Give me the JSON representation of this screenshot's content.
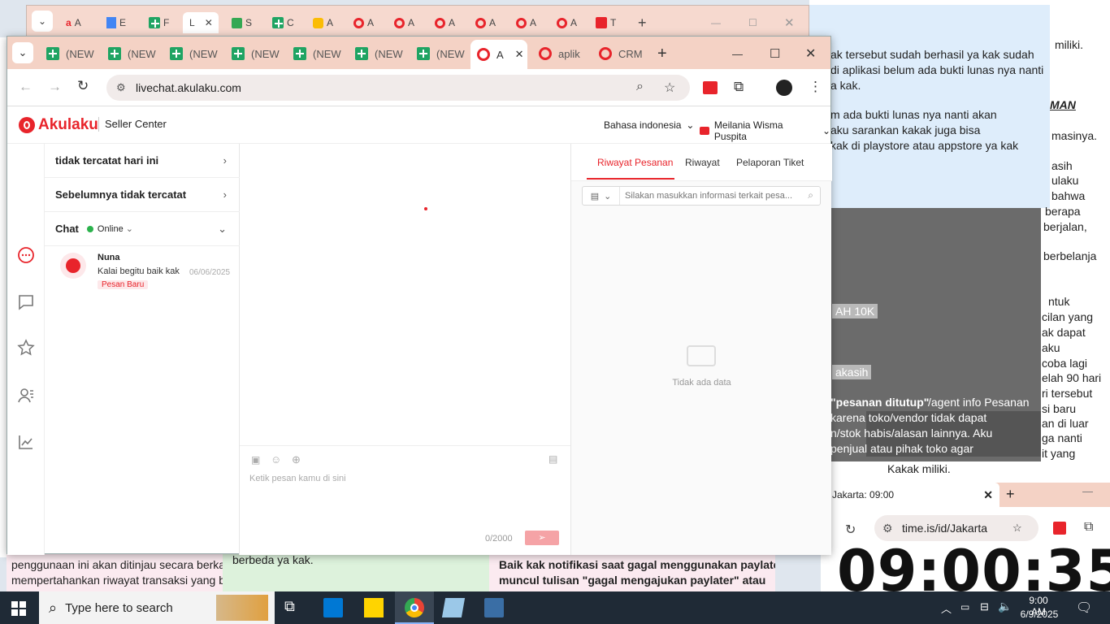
{
  "bg_top_window": {
    "tabs": [
      "A",
      "E",
      "F",
      "L",
      "S",
      "C",
      "A",
      "A",
      "A",
      "A",
      "A",
      "A",
      "T"
    ],
    "add_tab": "+"
  },
  "right_doc": {
    "blue_lines": [
      "ak tersebut sudah berhasil ya kak sudah",
      "di aplikasi belum ada bukti lunas nya nanti",
      "a kak.",
      "m ada bukti lunas nya nanti akan",
      " aku sarankan kakak juga bisa",
      "kak di playstore atau appstore ya kak"
    ],
    "side_lines": [
      "miliki.",
      "MAN",
      "masinya.",
      "asih",
      "ulaku",
      "bahwa",
      "berapa",
      "berjalan,",
      "berbelanja",
      "ntuk",
      "cilan yang",
      "ak dapat",
      "aku",
      "coba lagi",
      "elah 90 hari",
      "ri tersebut",
      "si baru",
      "an di luar",
      "ga nanti",
      "it yang"
    ],
    "popup_label_1": "AH 10K",
    "popup_label_2": "akasih",
    "bold_phrase": "\"pesanan ditutup\"",
    "popup_lines": [
      "/agent info Pesanan",
      "karena toko/vendor tidak dapat",
      "n/stok habis/alasan lainnya. Aku",
      "penjual atau pihak toko agar"
    ],
    "last_line": "Kakak miliki."
  },
  "bottom_strips": {
    "left_line1": "penggunaan ini akan ditinjau secara berka",
    "left_line2": "mempertahankan riwayat transaksi yang b",
    "middle_line": "berbeda ya kak.",
    "right_line1": "Baik kak notifikasi saat gagal menggunakan paylate",
    "right_line2": "muncul tulisan \"gagal mengajukan paylater\" atau"
  },
  "clock_window": {
    "tab_title": "Jakarta: 09:00",
    "url": "time.is/id/Jakarta",
    "time": "09:00:35"
  },
  "browser": {
    "tabs": [
      "(NEW",
      "(NEW",
      "(NEW",
      "(NEW",
      "(NEW",
      "(NEW",
      "(NEW",
      "A",
      "aplik",
      "CRM"
    ],
    "active_tab_index": 7,
    "url": "livechat.akulaku.com"
  },
  "seller_center": {
    "logo": "Akulaku",
    "section": "Seller Center",
    "language": "Bahasa indonesia",
    "user": "Meilania Wisma Puspita"
  },
  "list": {
    "row1": "tidak tercatat hari ini",
    "row2": "Sebelumnya tidak tercatat",
    "chat_label": "Chat",
    "status": "Online",
    "conversation": {
      "name": "Nuna",
      "message": "Kalai begitu baik kak",
      "date": "06/06/2025",
      "badge": "Pesan Baru"
    }
  },
  "composer": {
    "placeholder": "Ketik pesan kamu di sini",
    "counter": "0/2000"
  },
  "right_panel": {
    "tabs": [
      "Riwayat Pesanan",
      "Riwayat",
      "Pelaporan Tiket"
    ],
    "search_placeholder": "Silakan masukkan informasi terkait pesa...",
    "empty_text": "Tidak ada data"
  },
  "taskbar": {
    "search_placeholder": "Type here to search",
    "time": "9:00 AM",
    "date": "6/9/2025"
  },
  "colors": {
    "brand_red": "#e8242b",
    "tab_bar": "#f4d2c5",
    "taskbar": "#1f2a36"
  }
}
